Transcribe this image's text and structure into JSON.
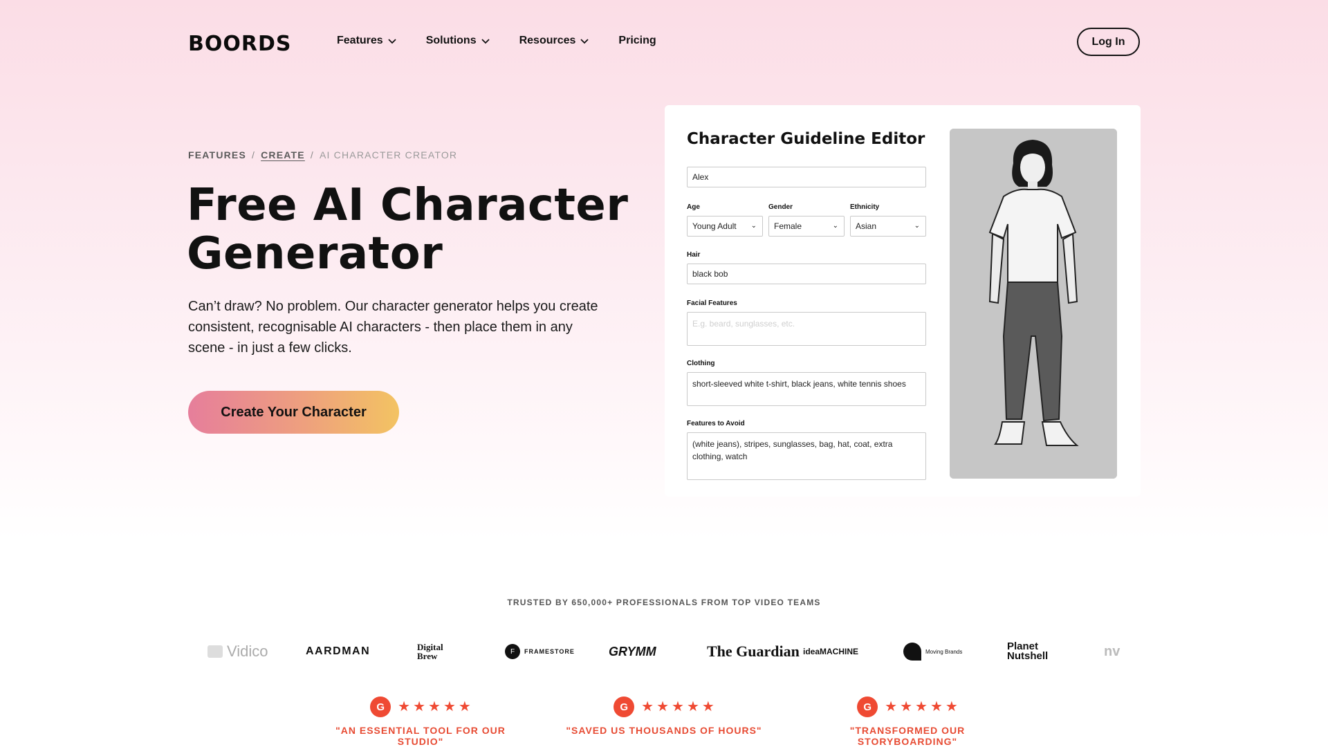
{
  "nav": {
    "logo": "BOORDS",
    "links": [
      "Features",
      "Solutions",
      "Resources",
      "Pricing"
    ],
    "login": "Log In"
  },
  "breadcrumb": {
    "items": [
      "FEATURES",
      "CREATE",
      "AI CHARACTER CREATOR"
    ],
    "sep": "/"
  },
  "hero": {
    "title_line1": "Free AI Character",
    "title_line2": "Generator",
    "description": "Can’t draw? No problem. Our character generator helps you create consistent, recognisable AI characters - then place them in any scene - in just a few clicks.",
    "cta": "Create Your Character"
  },
  "editor": {
    "title": "Character Guideline Editor",
    "name_value": "Alex",
    "age_label": "Age",
    "age_value": "Young Adult",
    "gender_label": "Gender",
    "gender_value": "Female",
    "ethnicity_label": "Ethnicity",
    "ethnicity_value": "Asian",
    "hair_label": "Hair",
    "hair_value": "black bob",
    "facial_label": "Facial Features",
    "facial_placeholder": "E.g. beard, sunglasses, etc.",
    "clothing_label": "Clothing",
    "clothing_value": "short-sleeved white t-shirt, black jeans, white tennis shoes",
    "avoid_label": "Features to Avoid",
    "avoid_value": "(white jeans), stripes, sunglasses, bag, hat, coat, extra clothing, watch"
  },
  "trust": {
    "heading": "TRUSTED BY 650,000+ PROFESSIONALS FROM TOP VIDEO TEAMS",
    "logos": [
      "Vidico",
      "AARDMAN",
      "Digital Brew",
      "FRAMESTORE",
      "GRYMM",
      "The Guardian",
      "ideaMACHINE",
      "Moving Brands",
      "Planet Nutshell",
      "nv"
    ]
  },
  "reviews": [
    {
      "badge": "G",
      "quote": "\"AN ESSENTIAL TOOL FOR OUR STUDIO\"",
      "stars": 5
    },
    {
      "badge": "G",
      "quote": "\"SAVED US THOUSANDS OF HOURS\"",
      "stars": 5
    },
    {
      "badge": "G",
      "quote": "\"TRANSFORMED OUR STORYBOARDING\"",
      "stars": 5
    }
  ],
  "colors": {
    "accent": "#ef4a33",
    "cta_start": "#e67e9b",
    "cta_end": "#f3c362"
  }
}
